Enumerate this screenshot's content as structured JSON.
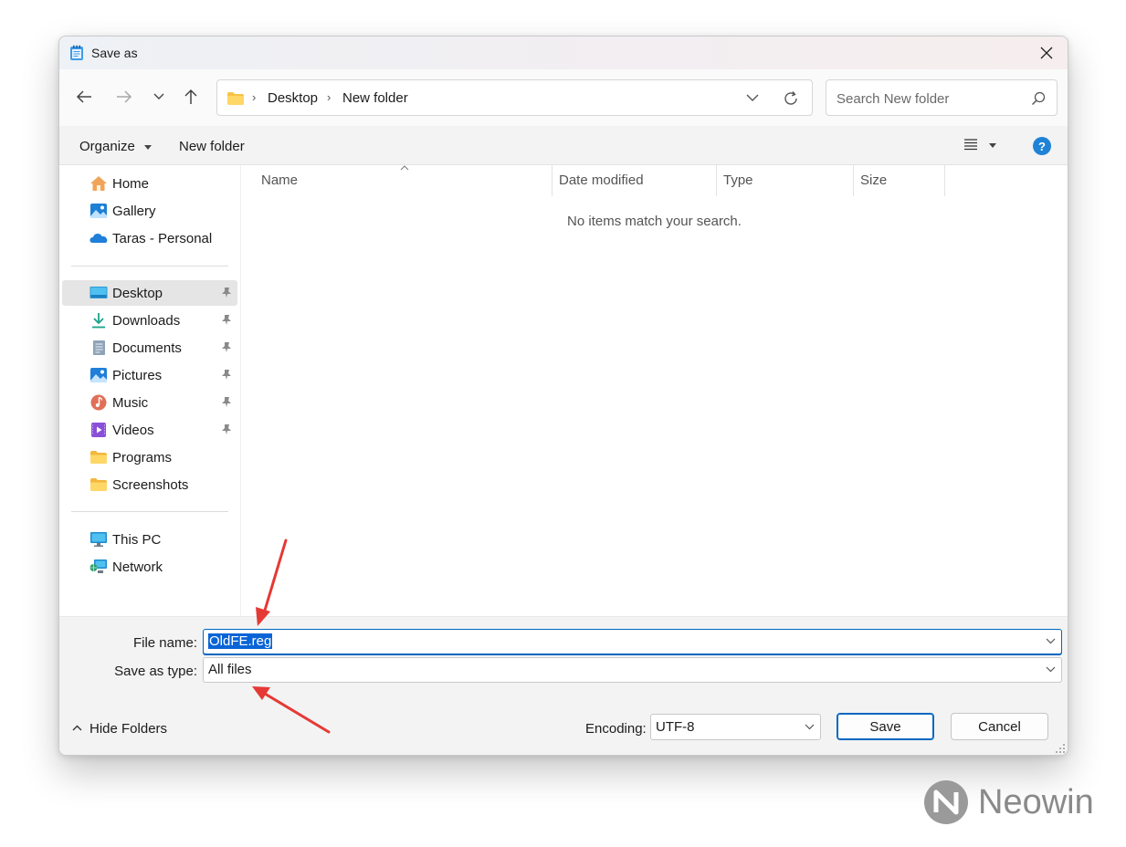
{
  "dialog": {
    "title": "Save as"
  },
  "nav": {
    "breadcrumbs": [
      "Desktop",
      "New folder"
    ],
    "search_placeholder": "Search New folder"
  },
  "toolbar": {
    "organize_label": "Organize",
    "new_folder_label": "New folder",
    "help_label": "?"
  },
  "sidebar": {
    "quick": [
      {
        "label": "Home",
        "icon": "home-icon"
      },
      {
        "label": "Gallery",
        "icon": "gallery-icon"
      },
      {
        "label": "Taras - Personal",
        "icon": "onedrive-cloud-icon"
      }
    ],
    "pinned": [
      {
        "label": "Desktop",
        "icon": "desktop-icon",
        "selected": true
      },
      {
        "label": "Downloads",
        "icon": "download-icon"
      },
      {
        "label": "Documents",
        "icon": "document-icon"
      },
      {
        "label": "Pictures",
        "icon": "pictures-icon"
      },
      {
        "label": "Music",
        "icon": "music-icon"
      },
      {
        "label": "Videos",
        "icon": "video-icon"
      },
      {
        "label": "Programs",
        "icon": "folder-icon"
      },
      {
        "label": "Screenshots",
        "icon": "folder-icon"
      }
    ],
    "devices": [
      {
        "label": "This PC",
        "icon": "computer-icon"
      },
      {
        "label": "Network",
        "icon": "network-icon"
      }
    ]
  },
  "file_list": {
    "columns": [
      "Name",
      "Date modified",
      "Type",
      "Size"
    ],
    "empty_message": "No items match your search."
  },
  "form": {
    "file_name_label": "File name:",
    "file_name_value": "OldFE.reg",
    "save_type_label": "Save as type:",
    "save_type_value": "All files",
    "encoding_label": "Encoding:",
    "encoding_value": "UTF-8",
    "hide_folders_label": "Hide Folders",
    "save_label": "Save",
    "cancel_label": "Cancel"
  },
  "watermark": {
    "text": "Neowin"
  },
  "colors": {
    "accent": "#0067c0",
    "selection": "#0a64d6",
    "annotation_arrow": "#e53935",
    "help_icon": "#1f82d6"
  }
}
